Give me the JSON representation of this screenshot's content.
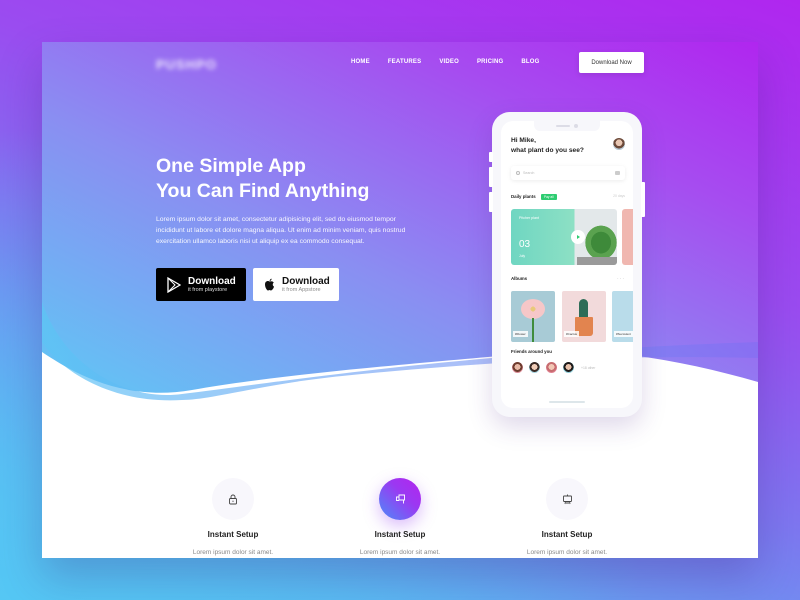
{
  "nav": {
    "logo": "PUSHPO",
    "items": [
      {
        "label": "HOME"
      },
      {
        "label": "FEATURES"
      },
      {
        "label": "VIDEO"
      },
      {
        "label": "PRICING"
      },
      {
        "label": "BLOG"
      }
    ],
    "cta_label": "Download Now"
  },
  "hero": {
    "title_line1": "One Simple App",
    "title_line2": "You Can Find Anything",
    "description": "Lorem ipsum dolor sit amet, consectetur adipisicing elit, sed do eiusmod tempor incididunt ut labore et dolore magna aliqua. Ut  enim ad minim veniam, quis nostrud exercitation ullamco laboris nisi ut aliquip ex ea commodo consequat.",
    "buttons": [
      {
        "icon": "google-play-icon",
        "label": "Download",
        "sub": "it from playstore"
      },
      {
        "icon": "apple-icon",
        "label": "Download",
        "sub": "it from Appstore"
      }
    ]
  },
  "phone": {
    "greeting_line1": "Hi Mike,",
    "greeting_line2": "what plant do you see?",
    "search_placeholder": "Search",
    "daily_title": "Daily plants",
    "pill_label": "Pay all",
    "days_label": "20 days",
    "card": {
      "name": "Pitcher plant",
      "day": "03",
      "month": "July"
    },
    "albums_title": "Albums",
    "albums": [
      {
        "tag": "#Flower"
      },
      {
        "tag": "#Cactus"
      },
      {
        "tag": "#Succulent"
      }
    ],
    "friends_title": "Friends around you",
    "friends_more": "+18 other"
  },
  "features": [
    {
      "icon": "lock-icon",
      "title": "Instant Setup",
      "desc": "Lorem ipsum dolor sit amet."
    },
    {
      "icon": "flag-icon",
      "title": "Instant Setup",
      "desc": "Lorem ipsum dolor sit amet."
    },
    {
      "icon": "monitor-icon",
      "title": "Instant Setup",
      "desc": "Lorem ipsum dolor sit amet."
    }
  ],
  "colors": {
    "gradient_start": "#55c4f3",
    "gradient_end": "#b026ef",
    "accent_green": "#2ecc71"
  }
}
